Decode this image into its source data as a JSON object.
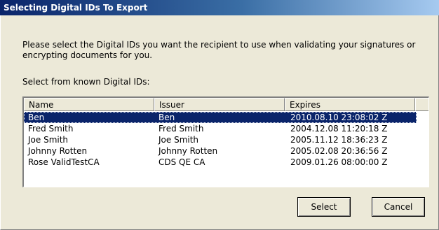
{
  "dialog": {
    "title": "Selecting Digital IDs To Export",
    "instruction": "Please select the Digital IDs you want the recipient to use when validating your signatures or encrypting documents for you.",
    "list_heading": "Select from known Digital IDs:"
  },
  "table": {
    "columns": [
      "Name",
      "Issuer",
      "Expires"
    ],
    "rows": [
      {
        "name": "Ben",
        "issuer": "Ben",
        "expires": "2010.08.10 23:08:02 Z"
      },
      {
        "name": "Fred Smith",
        "issuer": "Fred Smith",
        "expires": "2004.12.08 11:20:18 Z"
      },
      {
        "name": "Joe Smith",
        "issuer": "Joe Smith",
        "expires": "2005.11.12 18:36:23 Z"
      },
      {
        "name": "Johnny Rotten",
        "issuer": "Johnny Rotten",
        "expires": "2005.02.08 20:36:56 Z"
      },
      {
        "name": "Rose ValidTestCA",
        "issuer": "CDS QE CA",
        "expires": "2009.01.26 08:00:00 Z"
      }
    ]
  },
  "buttons": {
    "select": "Select",
    "cancel": "Cancel"
  },
  "colors": {
    "selection": "#0a246a",
    "window": "#ece9d8"
  }
}
